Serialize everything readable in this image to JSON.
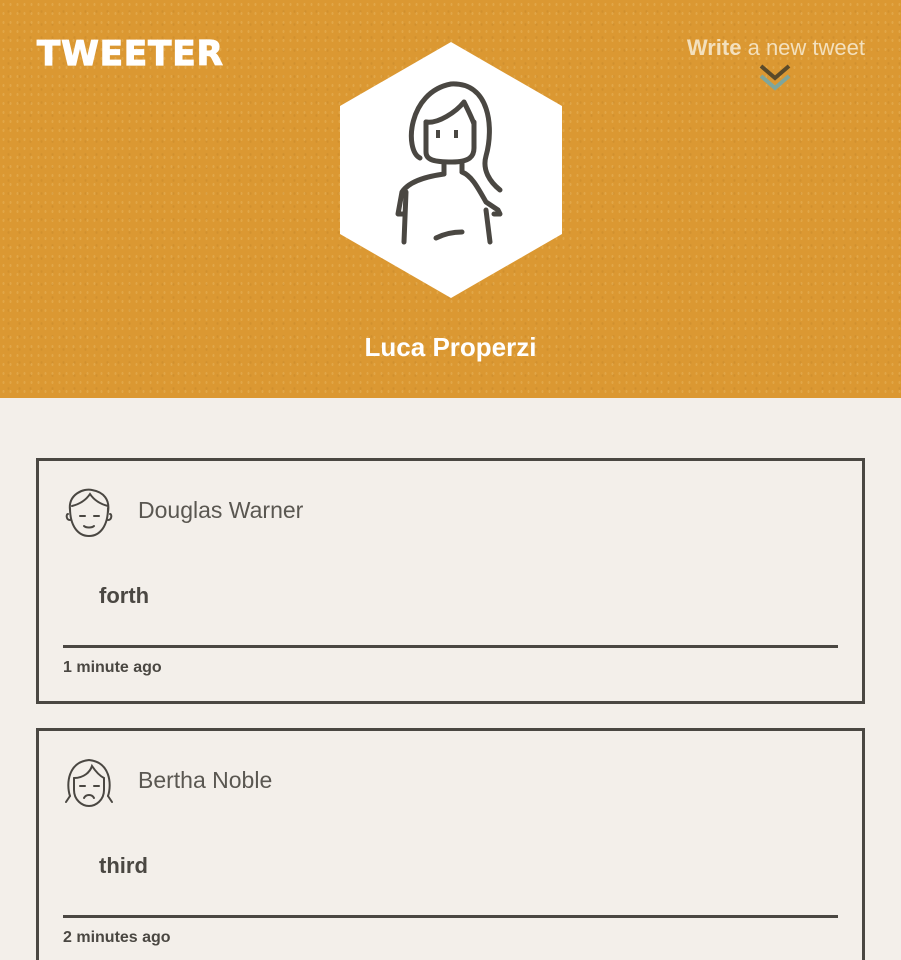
{
  "header": {
    "logo": "TWEETER",
    "compose": {
      "bold": "Write",
      "rest": " a new tweet"
    },
    "profile_name": "Luca Properzi",
    "background_color": "#db9832"
  },
  "tweets": [
    {
      "author": "Douglas Warner",
      "text": "forth",
      "time": "1 minute ago",
      "avatar_icon": "male-avatar-icon"
    },
    {
      "author": "Bertha Noble",
      "text": "third",
      "time": "2 minutes ago",
      "avatar_icon": "female-avatar-icon"
    }
  ],
  "colors": {
    "page_bg": "#f3efea",
    "ink": "#4a4742",
    "accent": "#db9832",
    "arrow_teal": "#7fa69b"
  }
}
